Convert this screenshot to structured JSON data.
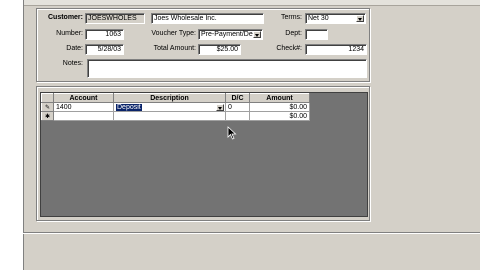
{
  "header": {
    "customer_label": "Customer:",
    "customer_id": "JOESWHOLES",
    "customer_name": "Joes Wholesale Inc.",
    "terms_label": "Terms:",
    "terms_value": "Net 30",
    "number_label": "Number:",
    "number_value": "1063",
    "voucher_type_label": "Voucher Type:",
    "voucher_type_value": "Pre-Payment/Dep",
    "dept_label": "Dept:",
    "dept_value": "",
    "date_label": "Date:",
    "date_value": "5/28/03",
    "total_amount_label": "Total Amount:",
    "total_amount_value": "$25.00",
    "check_label": "Check#:",
    "check_value": "1234",
    "notes_label": "Notes:",
    "notes_value": ""
  },
  "grid": {
    "columns": [
      "Account",
      "Description",
      "D/C",
      "Amount"
    ],
    "rows": [
      {
        "marker": "✎",
        "account": "1400",
        "description": "Deposit",
        "dc": "0",
        "amount": "$0.00"
      },
      {
        "marker": "✱",
        "account": "",
        "description": "",
        "dc": "",
        "amount": "$0.00"
      }
    ]
  },
  "icons": {
    "edit_row": "pencil-icon",
    "new_row": "asterisk-icon",
    "cursor": "mouse-pointer-icon"
  }
}
